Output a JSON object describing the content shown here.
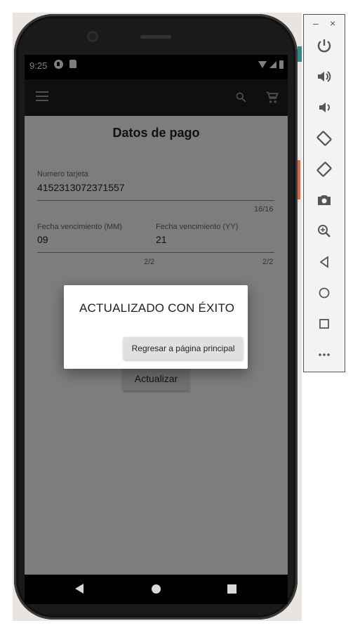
{
  "status_bar": {
    "time": "9:25"
  },
  "app_bar": {
    "menu_icon": "menu-icon",
    "search_icon": "search-icon",
    "cart_icon": "cart-icon"
  },
  "page": {
    "title": "Datos de pago",
    "card_number": {
      "label": "Numero tarjeta",
      "value": "4152313072371557",
      "counter": "16/16"
    },
    "exp_month": {
      "label": "Fecha vencimiento (MM)",
      "value": "09",
      "counter": "2/2"
    },
    "exp_year": {
      "label": "Fecha vencimiento (YY)",
      "value": "21",
      "counter": "2/2"
    },
    "update_button": "Actualizar"
  },
  "dialog": {
    "message": "ACTUALIZADO CON ÉXITO",
    "button": "Regresar a página principal"
  },
  "emulator_panel": {
    "minimize": "–",
    "close": "×",
    "tools": [
      "power-icon",
      "volume-up-icon",
      "volume-down-icon",
      "rotate-left-icon",
      "rotate-right-icon",
      "camera-icon",
      "zoom-icon",
      "back-icon",
      "home-icon",
      "overview-icon",
      "more-icon"
    ]
  },
  "colors": {
    "scrim": "#000000",
    "dialog_button": "#e0e0e0",
    "appbar": "#1f1f1f"
  }
}
